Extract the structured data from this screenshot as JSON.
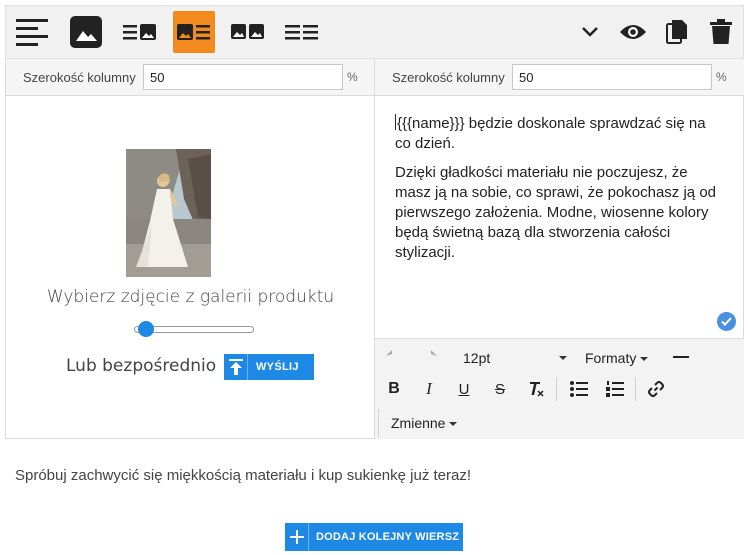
{
  "colors": {
    "accent": "#1e88e5",
    "active_layout": "#f28a1e",
    "toolbar_bg": "#f1f1f1"
  },
  "toolbar": {
    "layouts": [
      {
        "icon": "text-align-icon",
        "active": false
      },
      {
        "icon": "image-icon",
        "active": false
      },
      {
        "icon": "text-image-layout-icon",
        "active": false
      },
      {
        "icon": "image-text-layout-icon",
        "active": true
      },
      {
        "icon": "two-images-layout-icon",
        "active": false
      },
      {
        "icon": "two-texts-layout-icon",
        "active": false
      }
    ],
    "actions": [
      "chevron-down-icon",
      "eye-icon",
      "copy-icon",
      "trash-icon"
    ]
  },
  "left_column": {
    "width_label": "Szerokość kolumny",
    "width_value": "50",
    "width_unit": "%",
    "pick_label": "Wybierz zdjęcie z galerii produktu",
    "direct_label": "Lub bezpośrednio",
    "send_label": "WYŚLIJ",
    "slider_value": 0.1
  },
  "right_column": {
    "width_label": "Szerokość kolumny",
    "width_value": "50",
    "width_unit": "%",
    "paragraphs": [
      "{{{name}}} będzie doskonale sprawdzać się na co dzień.",
      "Dzięki gładkości materiału nie poczujesz, że masz ją na sobie, co sprawi, że pokochasz ją od pierwszego założenia. Modne, wiosenne kolory będą świetną bazą dla stworzenia całości stylizacji."
    ],
    "editor": {
      "font_size": "12pt",
      "formats_label": "Formaty",
      "variables_label": "Zmienne"
    }
  },
  "footer": {
    "text": "Spróbuj zachwycić się miękkością materiału i kup sukienkę już teraz!",
    "add_row_label": "DODAJ KOLEJNY WIERSZ"
  }
}
